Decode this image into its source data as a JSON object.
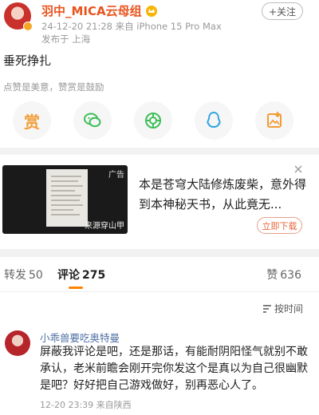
{
  "post": {
    "username": "羽中_MICA云母组",
    "meta": "24-12-20 21:28  来自 iPhone 15 Pro Max",
    "location": "发布于 上海",
    "follow_label": "+关注",
    "text": "垂死挣扎",
    "reward_hint": "点赞是美意，赞赏是鼓励",
    "reward_buttons": [
      {
        "icon": "reward-coin-icon",
        "glyph": "赏",
        "color": "#f39c35"
      },
      {
        "icon": "wechat-icon",
        "color": "#3dbf58"
      },
      {
        "icon": "moments-icon",
        "color": "#3dbf58"
      },
      {
        "icon": "qq-icon",
        "color": "#2fa6e0"
      },
      {
        "icon": "save-image-icon",
        "color": "#f39c35"
      }
    ]
  },
  "ad": {
    "tag": "广告",
    "source": "来源穿山甲",
    "title": "本是苍穹大陆修炼废柴，意外得到本神秘天书，从此竟无...",
    "cta_label": "立即下载"
  },
  "tabs": [
    {
      "label": "转发",
      "count": "50"
    },
    {
      "label": "评论",
      "count": "275"
    },
    {
      "label": "赞",
      "count": "636"
    }
  ],
  "sort_label": "按时间",
  "comment": {
    "username": "小乖兽要吃奥特曼",
    "text": "屏蔽我评论是吧，还是那话，有能耐阴阳怪气就别不敢承认，老米前瞻会刚开完你发这个是真以为自己很幽默是吧？好好把自己游戏做好，别再恶心人了。",
    "meta": "12-20 23:39  来自陕西"
  },
  "colors": {
    "accent": "#ff8200",
    "username": "#e8541e",
    "link": "#4d6fa3"
  }
}
